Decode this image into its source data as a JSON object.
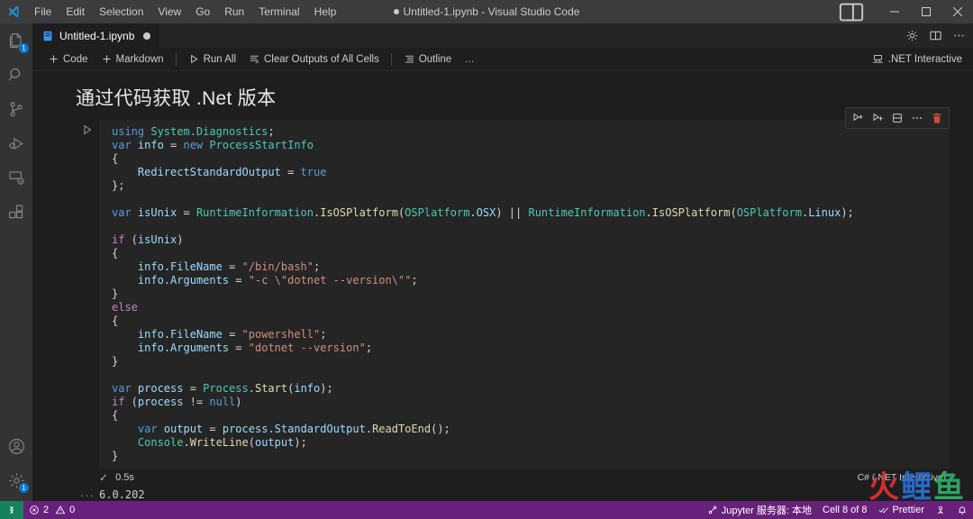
{
  "window": {
    "title": "Untitled-1.ipynb - Visual Studio Code",
    "dirty": true
  },
  "menubar": {
    "items": [
      {
        "label": "File"
      },
      {
        "label": "Edit"
      },
      {
        "label": "Selection"
      },
      {
        "label": "View"
      },
      {
        "label": "Go"
      },
      {
        "label": "Run"
      },
      {
        "label": "Terminal"
      },
      {
        "label": "Help"
      }
    ]
  },
  "window_controls": {
    "layout_icon": "editor-layout-icon",
    "minimize": "minimize-icon",
    "maximize": "maximize-icon",
    "close": "close-icon"
  },
  "activitybar": {
    "top_items": [
      {
        "name": "explorer",
        "icon": "files-icon",
        "badge": "1"
      },
      {
        "name": "search",
        "icon": "search-icon",
        "badge": ""
      },
      {
        "name": "source-control",
        "icon": "source-control-icon",
        "badge": ""
      },
      {
        "name": "run-and-debug",
        "icon": "run-debug-icon",
        "badge": ""
      },
      {
        "name": "remote-explorer",
        "icon": "remote-explorer-icon",
        "badge": ""
      },
      {
        "name": "extensions",
        "icon": "extensions-icon",
        "badge": ""
      }
    ],
    "bottom_items": [
      {
        "name": "accounts",
        "icon": "account-icon",
        "badge": ""
      },
      {
        "name": "manage",
        "icon": "gear-icon",
        "badge": "1"
      }
    ]
  },
  "tabs": [
    {
      "label": "Untitled-1.ipynb",
      "icon": "notebook-icon",
      "dirty": true,
      "active": true
    }
  ],
  "tabbar_actions": [
    {
      "name": "settings",
      "icon": "gear-icon"
    },
    {
      "name": "split-editor",
      "icon": "split-editor-icon"
    },
    {
      "name": "more-actions",
      "icon": "ellipsis-icon"
    }
  ],
  "notebook_toolbar": {
    "buttons": [
      {
        "label": "Code",
        "icon": "plus-icon"
      },
      {
        "label": "Markdown",
        "icon": "plus-icon"
      },
      {
        "label": "Run All",
        "icon": "run-all-icon"
      },
      {
        "label": "Clear Outputs of All Cells",
        "icon": "clear-outputs-icon"
      },
      {
        "label": "Outline",
        "icon": "outline-icon"
      },
      {
        "label": "…",
        "icon": "ellipsis-icon"
      }
    ],
    "kernel": {
      "label": ".NET Interactive",
      "icon": "kernel-icon"
    }
  },
  "cells": [
    {
      "type": "markdown",
      "title": "通过代码获取 .Net 版本"
    },
    {
      "type": "code",
      "language": "csharp",
      "execution_status": "0.5s",
      "execution_check": "✓",
      "kernel_label": "C# (.NET Interactive)",
      "toolbar": [
        {
          "name": "execute-above-cells",
          "icon": "run-above-icon"
        },
        {
          "name": "execute-cell-and-below",
          "icon": "run-below-icon"
        },
        {
          "name": "split-cell",
          "icon": "split-cell-icon"
        },
        {
          "name": "more-actions",
          "icon": "ellipsis-icon"
        },
        {
          "name": "delete-cell",
          "icon": "trash-icon"
        }
      ],
      "source_lines": [
        [
          {
            "t": "using ",
            "c": "kw"
          },
          {
            "t": "System.Diagnostics",
            "c": "ns"
          },
          {
            "t": ";",
            "c": "plain"
          }
        ],
        [
          {
            "t": "var ",
            "c": "kw"
          },
          {
            "t": "info",
            "c": "var"
          },
          {
            "t": " = ",
            "c": "op"
          },
          {
            "t": "new ",
            "c": "kw"
          },
          {
            "t": "ProcessStartInfo",
            "c": "type"
          }
        ],
        [
          {
            "t": "{",
            "c": "plain"
          }
        ],
        [
          {
            "t": "    ",
            "c": "plain"
          },
          {
            "t": "RedirectStandardOutput",
            "c": "prop"
          },
          {
            "t": " = ",
            "c": "op"
          },
          {
            "t": "true",
            "c": "kw"
          }
        ],
        [
          {
            "t": "};",
            "c": "plain"
          }
        ],
        [
          {
            "t": "",
            "c": "plain"
          }
        ],
        [
          {
            "t": "var ",
            "c": "kw"
          },
          {
            "t": "isUnix",
            "c": "var"
          },
          {
            "t": " = ",
            "c": "op"
          },
          {
            "t": "RuntimeInformation",
            "c": "type"
          },
          {
            "t": ".",
            "c": "plain"
          },
          {
            "t": "IsOSPlatform",
            "c": "method"
          },
          {
            "t": "(",
            "c": "plain"
          },
          {
            "t": "OSPlatform",
            "c": "type"
          },
          {
            "t": ".",
            "c": "plain"
          },
          {
            "t": "OSX",
            "c": "prop"
          },
          {
            "t": ") ",
            "c": "plain"
          },
          {
            "t": "||",
            "c": "op"
          },
          {
            "t": " ",
            "c": "plain"
          },
          {
            "t": "RuntimeInformation",
            "c": "type"
          },
          {
            "t": ".",
            "c": "plain"
          },
          {
            "t": "IsOSPlatform",
            "c": "method"
          },
          {
            "t": "(",
            "c": "plain"
          },
          {
            "t": "OSPlatform",
            "c": "type"
          },
          {
            "t": ".",
            "c": "plain"
          },
          {
            "t": "Linux",
            "c": "prop"
          },
          {
            "t": ");",
            "c": "plain"
          }
        ],
        [
          {
            "t": "",
            "c": "plain"
          }
        ],
        [
          {
            "t": "if",
            "c": "ctrl"
          },
          {
            "t": " (",
            "c": "plain"
          },
          {
            "t": "isUnix",
            "c": "var"
          },
          {
            "t": ")",
            "c": "plain"
          }
        ],
        [
          {
            "t": "{",
            "c": "plain"
          }
        ],
        [
          {
            "t": "    ",
            "c": "plain"
          },
          {
            "t": "info",
            "c": "var"
          },
          {
            "t": ".",
            "c": "plain"
          },
          {
            "t": "FileName",
            "c": "prop"
          },
          {
            "t": " = ",
            "c": "op"
          },
          {
            "t": "\"/bin/bash\"",
            "c": "str"
          },
          {
            "t": ";",
            "c": "plain"
          }
        ],
        [
          {
            "t": "    ",
            "c": "plain"
          },
          {
            "t": "info",
            "c": "var"
          },
          {
            "t": ".",
            "c": "plain"
          },
          {
            "t": "Arguments",
            "c": "prop"
          },
          {
            "t": " = ",
            "c": "op"
          },
          {
            "t": "\"-c \\\"dotnet --version\\\"\"",
            "c": "str"
          },
          {
            "t": ";",
            "c": "plain"
          }
        ],
        [
          {
            "t": "}",
            "c": "plain"
          }
        ],
        [
          {
            "t": "else",
            "c": "ctrl"
          }
        ],
        [
          {
            "t": "{",
            "c": "plain"
          }
        ],
        [
          {
            "t": "    ",
            "c": "plain"
          },
          {
            "t": "info",
            "c": "var"
          },
          {
            "t": ".",
            "c": "plain"
          },
          {
            "t": "FileName",
            "c": "prop"
          },
          {
            "t": " = ",
            "c": "op"
          },
          {
            "t": "\"powershell\"",
            "c": "str"
          },
          {
            "t": ";",
            "c": "plain"
          }
        ],
        [
          {
            "t": "    ",
            "c": "plain"
          },
          {
            "t": "info",
            "c": "var"
          },
          {
            "t": ".",
            "c": "plain"
          },
          {
            "t": "Arguments",
            "c": "prop"
          },
          {
            "t": " = ",
            "c": "op"
          },
          {
            "t": "\"dotnet --version\"",
            "c": "str"
          },
          {
            "t": ";",
            "c": "plain"
          }
        ],
        [
          {
            "t": "}",
            "c": "plain"
          }
        ],
        [
          {
            "t": "",
            "c": "plain"
          }
        ],
        [
          {
            "t": "var ",
            "c": "kw"
          },
          {
            "t": "process",
            "c": "var"
          },
          {
            "t": " = ",
            "c": "op"
          },
          {
            "t": "Process",
            "c": "type"
          },
          {
            "t": ".",
            "c": "plain"
          },
          {
            "t": "Start",
            "c": "method"
          },
          {
            "t": "(",
            "c": "plain"
          },
          {
            "t": "info",
            "c": "var"
          },
          {
            "t": ");",
            "c": "plain"
          }
        ],
        [
          {
            "t": "if",
            "c": "ctrl"
          },
          {
            "t": " (",
            "c": "plain"
          },
          {
            "t": "process",
            "c": "var"
          },
          {
            "t": " != ",
            "c": "op"
          },
          {
            "t": "null",
            "c": "kw"
          },
          {
            "t": ")",
            "c": "plain"
          }
        ],
        [
          {
            "t": "{",
            "c": "plain"
          }
        ],
        [
          {
            "t": "    ",
            "c": "plain"
          },
          {
            "t": "var ",
            "c": "kw"
          },
          {
            "t": "output",
            "c": "var"
          },
          {
            "t": " = ",
            "c": "op"
          },
          {
            "t": "process",
            "c": "var"
          },
          {
            "t": ".",
            "c": "plain"
          },
          {
            "t": "StandardOutput",
            "c": "prop"
          },
          {
            "t": ".",
            "c": "plain"
          },
          {
            "t": "ReadToEnd",
            "c": "method"
          },
          {
            "t": "();",
            "c": "plain"
          }
        ],
        [
          {
            "t": "    ",
            "c": "plain"
          },
          {
            "t": "Console",
            "c": "type"
          },
          {
            "t": ".",
            "c": "plain"
          },
          {
            "t": "WriteLine",
            "c": "method"
          },
          {
            "t": "(",
            "c": "plain"
          },
          {
            "t": "output",
            "c": "var"
          },
          {
            "t": ");",
            "c": "plain"
          }
        ],
        [
          {
            "t": "}",
            "c": "plain"
          }
        ]
      ],
      "output": "6.0.202",
      "output_gutter": "···"
    }
  ],
  "statusbar": {
    "remote_icon": "remote-indicator-icon",
    "problems": {
      "errors": "2",
      "warnings": "0",
      "error_icon": "error-icon",
      "warning_icon": "warning-icon"
    },
    "right_items": [
      {
        "label": "Jupyter 服务器: 本地",
        "icon": "jupyter-server-icon",
        "name": "jupyter-server"
      },
      {
        "label": "Cell 8 of 8",
        "icon": "",
        "name": "cell-position"
      },
      {
        "label": "Prettier",
        "icon": "check-check-icon",
        "name": "prettier-status"
      },
      {
        "label": "",
        "icon": "broadcast-icon",
        "name": "live-share"
      },
      {
        "label": "",
        "icon": "bell-icon",
        "name": "notifications"
      }
    ]
  },
  "watermark": {
    "part1": "火",
    "part2": "鲤",
    "part3": "鱼"
  },
  "colors": {
    "titlebar_bg": "#3c3c3c",
    "activitybar_bg": "#333333",
    "editor_bg": "#1e1e1e",
    "cell_bg": "#252526",
    "statusbar_bg": "#68217a",
    "remote_bg": "#16825d",
    "accent": "#0078d4"
  }
}
